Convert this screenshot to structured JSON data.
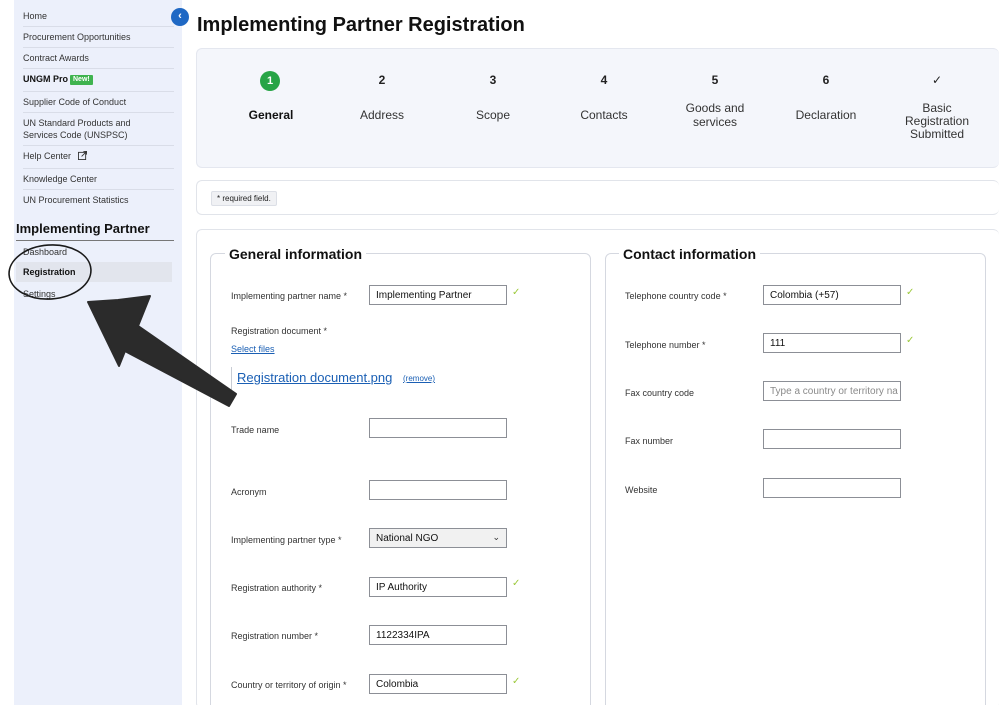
{
  "sidebar": {
    "nav": [
      {
        "label": "Home"
      },
      {
        "label": "Procurement Opportunities"
      },
      {
        "label": "Contract Awards"
      },
      {
        "label": "UNGM Pro",
        "badge": "New!"
      },
      {
        "label": "Supplier Code of Conduct"
      },
      {
        "label_line1": "UN Standard Products and",
        "label_line2": "Services Code (UNSPSC)"
      },
      {
        "label": "Help Center"
      },
      {
        "label": "Knowledge Center"
      },
      {
        "label": "UN Procurement Statistics"
      }
    ],
    "section_title": "Implementing Partner",
    "sub": [
      {
        "label": "Dashboard"
      },
      {
        "label": "Registration",
        "active": true
      },
      {
        "label": "Settings"
      }
    ]
  },
  "collapse_icon": "chevron-left-icon",
  "page_title": "Implementing Partner Registration",
  "steps": [
    {
      "num": "1",
      "label": "General",
      "current": true
    },
    {
      "num": "2",
      "label": "Address"
    },
    {
      "num": "3",
      "label": "Scope"
    },
    {
      "num": "4",
      "label": "Contacts"
    },
    {
      "num": "5",
      "label_line1": "Goods and",
      "label_line2": "services"
    },
    {
      "num": "6",
      "label": "Declaration"
    },
    {
      "num": "✓",
      "label_line1": "Basic",
      "label_line2": "Registration",
      "label_line3": "Submitted"
    }
  ],
  "required_note": "* required field.",
  "general": {
    "legend": "General information",
    "ip_name_label": "Implementing partner name *",
    "ip_name_value": "Implementing Partner",
    "reg_doc_label": "Registration document *",
    "select_files": "Select files",
    "file_name": "Registration document.png",
    "remove": "(remove)",
    "trade_name_label": "Trade name",
    "trade_name_value": "",
    "acronym_label": "Acronym",
    "acronym_value": "",
    "ip_type_label": "Implementing partner type *",
    "ip_type_value": "National NGO",
    "reg_authority_label": "Registration authority *",
    "reg_authority_value": "IP Authority",
    "reg_number_label": "Registration number *",
    "reg_number_value": "1122334IPA",
    "country_label": "Country or territory of origin *",
    "country_value": "Colombia"
  },
  "contact": {
    "legend": "Contact information",
    "tel_code_label": "Telephone country code *",
    "tel_code_value": "Colombia (+57)",
    "tel_num_label": "Telephone number *",
    "tel_num_value": "111",
    "fax_code_label": "Fax country code",
    "fax_code_placeholder": "Type a country or territory na",
    "fax_num_label": "Fax number",
    "fax_num_value": "",
    "website_label": "Website",
    "website_value": ""
  },
  "colors": {
    "accent": "#1f68c4",
    "step_current": "#27a446",
    "check": "#9cc93c",
    "new_badge": "#3fb34f",
    "sidebar_bg": "#ecf0fb"
  }
}
